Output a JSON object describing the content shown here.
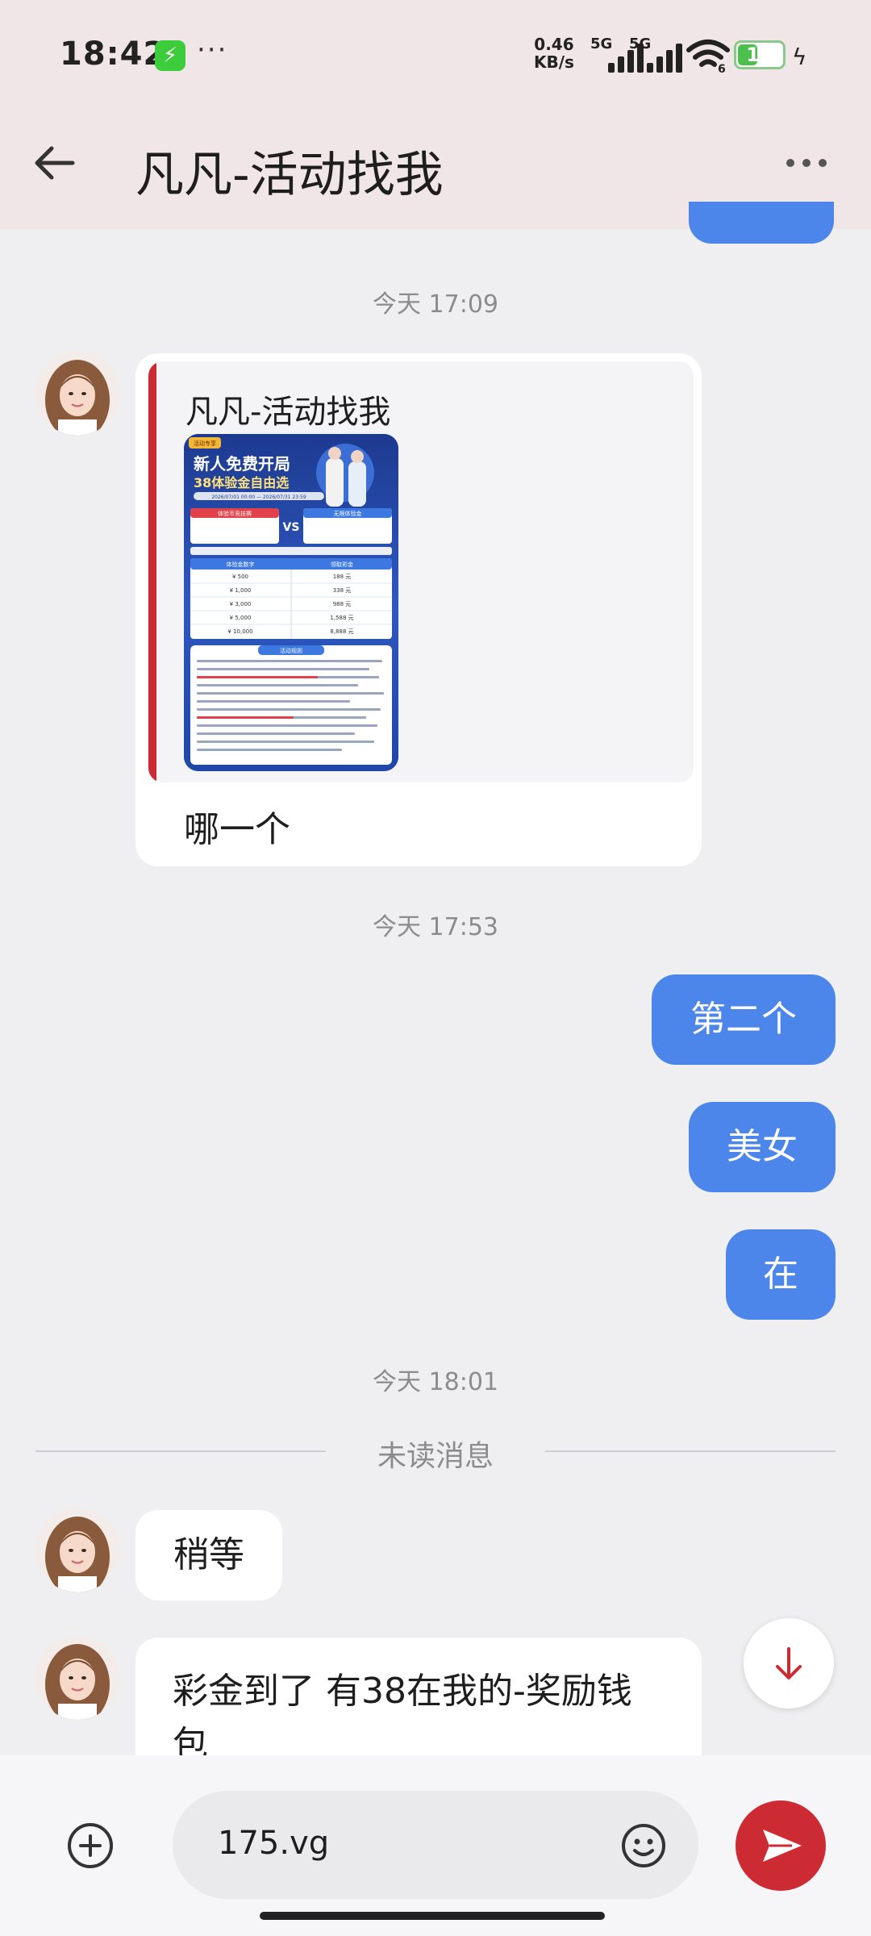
{
  "status_bar": {
    "time": "18:42",
    "dots": "···",
    "net_speed_value": "0.46",
    "net_speed_unit": "KB/s",
    "sim1": "5G",
    "sim2": "5G",
    "wifi_sub": "6",
    "battery_level": "11",
    "battery_fraction": 0.11
  },
  "header": {
    "title": "凡凡-活动找我"
  },
  "messages": {
    "time_1709": "今天 17:09",
    "shared_card_title": "凡凡-活动找我",
    "poster": {
      "tag": "活动专享",
      "headline1": "新人免费开局",
      "headline2": "38体验金自由选",
      "dates": "2026/07/01 00:00 — 2026/07/31 23:59",
      "left_box": "体验币竞技赛",
      "right_box": "无限体验金",
      "vs": "VS",
      "table_h1": "体验金数字",
      "table_h2": "领取彩金",
      "rows": [
        [
          "¥ 500",
          "188 元"
        ],
        [
          "¥ 1,000",
          "338 元"
        ],
        [
          "¥ 3,000",
          "988 元"
        ],
        [
          "¥ 5,000",
          "1,588 元"
        ],
        [
          "¥ 10,000",
          "8,888 元"
        ]
      ],
      "rules_title": "活动规则"
    },
    "which_one": "哪一个",
    "time_1753": "今天 17:53",
    "out_1": "第二个",
    "out_2": "美女",
    "out_3": "在",
    "time_1801": "今天 18:01",
    "unread": "未读消息",
    "in_wait": "稍等",
    "in_bonus": "彩金到了 有38在我的-奖励钱包"
  },
  "composer": {
    "input_value": "175.vg"
  },
  "colors": {
    "accent_blue": "#4d86ea",
    "send_red": "#cc2b33",
    "header_bg": "#f1e6e7",
    "chat_bg": "#efeff1"
  },
  "icons": [
    "back-arrow-icon",
    "more-icon",
    "plus-circle-icon",
    "emoji-icon",
    "send-icon",
    "arrow-down-icon",
    "wifi-icon",
    "signal-icon",
    "battery-icon",
    "charging-icon"
  ]
}
